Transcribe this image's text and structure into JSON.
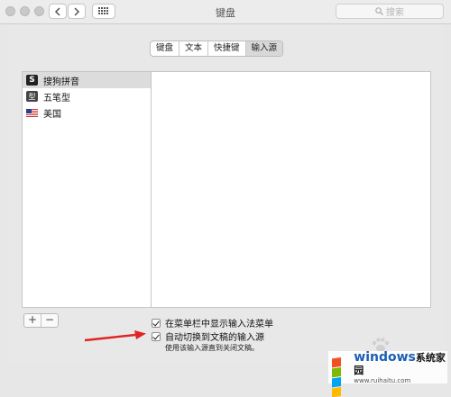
{
  "window": {
    "title": "键盘"
  },
  "search": {
    "placeholder": "搜索"
  },
  "tabs": [
    {
      "label": "键盘",
      "active": false
    },
    {
      "label": "文本",
      "active": false
    },
    {
      "label": "快捷键",
      "active": false
    },
    {
      "label": "输入源",
      "active": true
    }
  ],
  "sources": [
    {
      "label": "搜狗拼音",
      "icon": "sogou-icon",
      "selected": true
    },
    {
      "label": "五笔型",
      "icon": "wubi-icon",
      "selected": false
    },
    {
      "label": "美国",
      "icon": "us-flag-icon",
      "selected": false
    }
  ],
  "icons": {
    "sogou": "S",
    "wubi": "型"
  },
  "buttons": {
    "add": "+",
    "remove": "−"
  },
  "options": {
    "show_menu": {
      "label": "在菜单栏中显示输入法菜单",
      "checked": true
    },
    "auto_switch": {
      "label": "自动切换到文稿的输入源",
      "checked": true
    },
    "hint": "使用该输入源直到关闭文稿。"
  },
  "watermark": {
    "brand": "windows",
    "suffix": "系统家园",
    "url": "www.ruihaitu.com"
  }
}
